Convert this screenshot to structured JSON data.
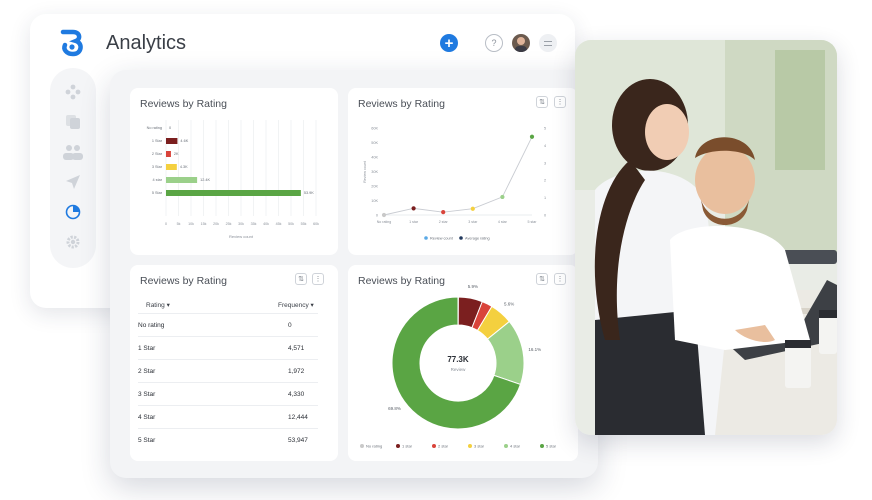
{
  "app": {
    "title": "Analytics"
  },
  "colors": {
    "no_rating": "#c9c9c9",
    "star1": "#7b1f1f",
    "star2": "#d9443b",
    "star3": "#f4d03f",
    "star4": "#9bd08a",
    "star5": "#5aa544",
    "accent": "#1f7ae0"
  },
  "sidebar": {
    "items": [
      {
        "icon": "nodes-icon"
      },
      {
        "icon": "copy-icon"
      },
      {
        "icon": "users-icon"
      },
      {
        "icon": "send-icon"
      },
      {
        "icon": "pie-chart-icon",
        "active": true
      },
      {
        "icon": "gear-icon"
      }
    ]
  },
  "cards": {
    "bar": {
      "title": "Reviews by Rating"
    },
    "line": {
      "title": "Reviews by Rating"
    },
    "table": {
      "title": "Reviews by Rating",
      "col1": "Rating",
      "col2": "Frequency"
    },
    "donut": {
      "title": "Reviews by Rating"
    }
  },
  "chart_data": [
    {
      "type": "bar",
      "title": "Reviews by Rating",
      "categories": [
        "No rating",
        "1 Star",
        "2 Star",
        "3 Star",
        "4 star",
        "5 Star"
      ],
      "values": [
        0,
        4571,
        1972,
        4330,
        12444,
        53947
      ],
      "value_labels": [
        "0",
        "4.6K",
        "2K",
        "4.3K",
        "12.4K",
        "53.9K"
      ],
      "xlabel": "Review count",
      "xticks": [
        "0",
        "5k",
        "10k",
        "15k",
        "20k",
        "25k",
        "30k",
        "35k",
        "40k",
        "45k",
        "50k",
        "55k",
        "60k"
      ],
      "xlim": [
        0,
        60000
      ]
    },
    {
      "type": "line",
      "title": "Reviews by Rating",
      "categories": [
        "No rating",
        "1 star",
        "2 star",
        "3 star",
        "4 star",
        "5 star"
      ],
      "series": [
        {
          "name": "Review count",
          "values": [
            0,
            4571,
            1972,
            4330,
            12444,
            53947
          ]
        },
        {
          "name": "Average rating",
          "values": [
            0,
            1,
            2,
            3,
            4,
            5
          ]
        }
      ],
      "ylabel": "Review count",
      "yticks": [
        "0",
        "10K",
        "20K",
        "30K",
        "40K",
        "50K",
        "60K"
      ],
      "y2ticks": [
        "0",
        "1",
        "2",
        "3",
        "4",
        "5"
      ]
    },
    {
      "type": "table",
      "columns": [
        "Rating",
        "Frequency"
      ],
      "rows": [
        [
          "No rating",
          "0"
        ],
        [
          "1 Star",
          "4,571"
        ],
        [
          "2 Star",
          "1,972"
        ],
        [
          "3 Star",
          "4,330"
        ],
        [
          "4 Star",
          "12,444"
        ],
        [
          "5 Star",
          "53,947"
        ]
      ]
    },
    {
      "type": "pie",
      "center_value": "77.3K",
      "center_label": "Review",
      "labels": [
        "No rating",
        "1 star",
        "2 star",
        "3 star",
        "4 star",
        "5 star"
      ],
      "values": [
        0.1,
        5.9,
        2.6,
        5.6,
        16.1,
        69.8
      ],
      "slice_labels": [
        "",
        "5.9%",
        "",
        "5.6%",
        "16.1%",
        "69.8%"
      ]
    }
  ]
}
